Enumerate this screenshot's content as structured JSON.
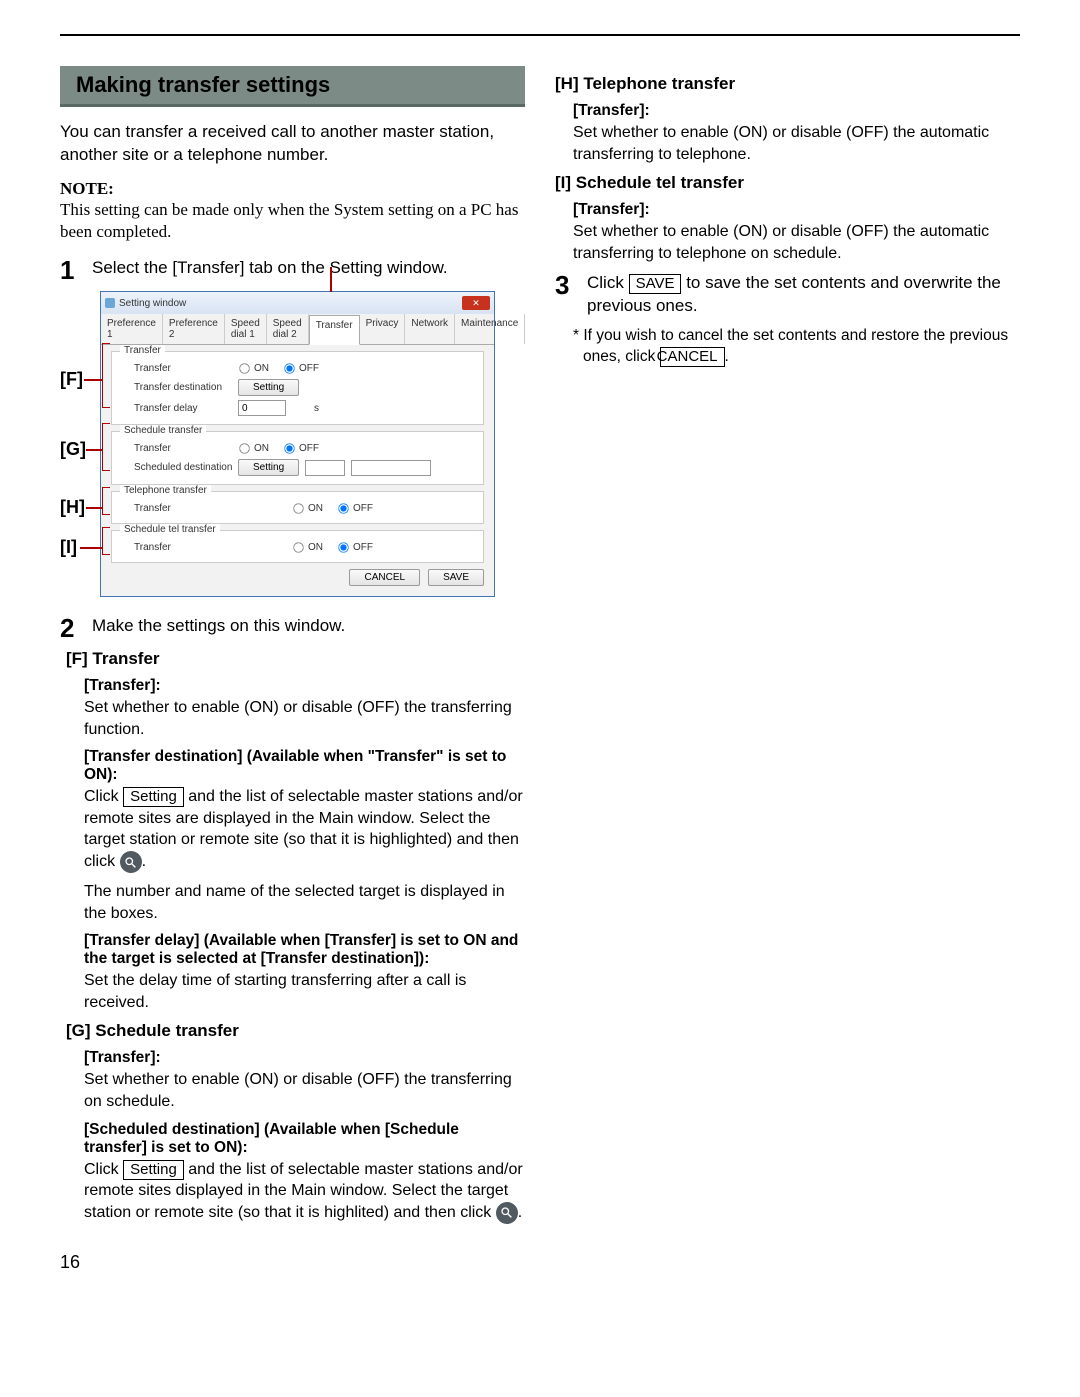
{
  "page_number": "16",
  "heading": "Making transfer settings",
  "intro": "You can transfer a received call to another master station, another site or a telephone number.",
  "note_label": "NOTE:",
  "note_text": "This setting can be made only when the System setting on a PC has been completed.",
  "step1": "Select the [Transfer] tab on the Setting window.",
  "step2": "Make the settings on this window.",
  "step3_pre": "Click ",
  "step3_btn": "SAVE",
  "step3_post": " to save the set contents and overwrite the previous ones.",
  "step3_note_pre": "* If you wish to cancel the set contents and restore the previous ones, click ",
  "step3_note_btn": "CANCEL",
  "step3_note_post": ".",
  "callouts": {
    "F": "[F]",
    "G": "[G]",
    "H": "[H]",
    "I": "[I]"
  },
  "sw": {
    "title": "Setting window",
    "tabs": [
      "Preference 1",
      "Preference 2",
      "Speed dial 1",
      "Speed dial 2",
      "Transfer",
      "Privacy",
      "Network",
      "Maintenance"
    ],
    "active_tab_index": 4,
    "on": "ON",
    "off": "OFF",
    "setting_btn": "Setting",
    "transfer_group": "Transfer",
    "transfer_label": "Transfer",
    "transfer_dest_label": "Transfer destination",
    "transfer_delay_label": "Transfer delay",
    "transfer_delay_value": "0",
    "transfer_delay_unit": "s",
    "schedule_group": "Schedule transfer",
    "schedule_label": "Transfer",
    "sched_dest_label": "Scheduled destination",
    "tel_group": "Telephone transfer",
    "tel_label": "Transfer",
    "sched_tel_group": "Schedule tel transfer",
    "sched_tel_label": "Transfer",
    "cancel": "CANCEL",
    "save": "SAVE"
  },
  "F": {
    "head": "[F] Transfer",
    "t_label": "[Transfer]:",
    "t_text": "Set whether to enable (ON) or disable (OFF) the transferring function.",
    "td_label": "[Transfer destination] (Available when \"Transfer\" is set to ON):",
    "td_pre": "Click ",
    "td_btn": "Setting",
    "td_mid": " and the list of selectable master stations and/or remote sites are displayed in the Main window. Select the target station or remote site (so that it is highlighted) and then click ",
    "td_post": ".",
    "td_text2": "The number and name of the selected target is displayed in the boxes.",
    "dl_label": "[Transfer delay] (Available when [Transfer] is set to ON and the target is selected at [Transfer destination]):",
    "dl_text": "Set the delay time of starting transferring after a call is received."
  },
  "G": {
    "head": "[G] Schedule transfer",
    "t_label": "[Transfer]:",
    "t_text": "Set whether to enable (ON) or disable (OFF) the transferring on schedule.",
    "sd_label": "[Scheduled destination] (Available when [Schedule transfer] is set to ON):",
    "sd_pre": "Click ",
    "sd_btn": "Setting",
    "sd_mid": " and the list of selectable master stations and/or remote sites displayed in the Main window. Select the target station or remote site (so that it is highlited) and then click ",
    "sd_post": "."
  },
  "H": {
    "head": "[H] Telephone transfer",
    "t_label": "[Transfer]:",
    "t_text": "Set whether to enable (ON) or disable (OFF) the automatic transferring to telephone."
  },
  "I": {
    "head": "[I] Schedule tel transfer",
    "t_label": "[Transfer]:",
    "t_text": "Set whether to enable (ON) or disable (OFF) the automatic transferring to telephone on schedule."
  }
}
